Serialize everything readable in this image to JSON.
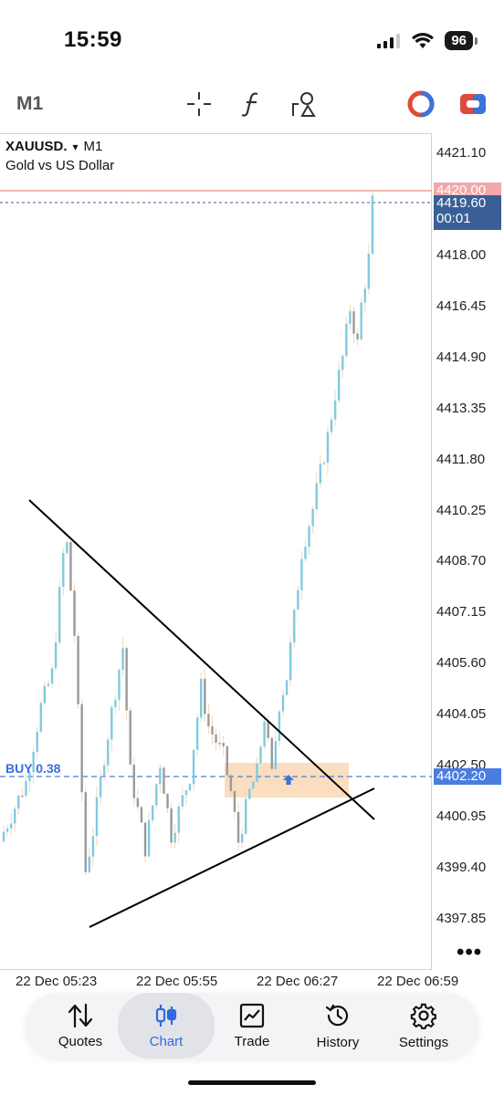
{
  "status_bar": {
    "time": "15:59",
    "battery": "96"
  },
  "toolbar": {
    "period": "M1",
    "icons": [
      "crosshair-icon",
      "function-icon",
      "objects-icon",
      "trade-panel-icon",
      "one-click-icon"
    ]
  },
  "chart": {
    "symbol": "XAUUSD.",
    "symbol_arrow": "▾",
    "timeframe": "M1",
    "description": "Gold vs US Dollar",
    "price_labels": [
      "4421.10",
      "4418.00",
      "4416.45",
      "4414.90",
      "4413.35",
      "4411.80",
      "4410.25",
      "4408.70",
      "4407.15",
      "4405.60",
      "4404.05",
      "4402.50",
      "4400.95",
      "4399.40",
      "4397.85"
    ],
    "ask_tag": {
      "price": "4420.00",
      "color": "#f0a8a8"
    },
    "bid_tag": {
      "price": "4419.60",
      "countdown": "00:01",
      "color": "#3a5f96"
    },
    "buy_line": {
      "label": "BUY 0.38",
      "price": "4402.20",
      "color": "#4a7de0"
    },
    "time_labels": [
      "22 Dec 05:23",
      "22 Dec 05:55",
      "22 Dec 06:27",
      "22 Dec 06:59"
    ],
    "more": "•••",
    "colors": {
      "bull": "#7ecbe0",
      "bear": "#9a9a9a",
      "highlight": "#f9d8b4",
      "trendline": "#000000"
    }
  },
  "nav": {
    "items": [
      {
        "label": "Quotes",
        "icon": "quotes-arrows-icon"
      },
      {
        "label": "Chart",
        "icon": "candles-icon",
        "active": true
      },
      {
        "label": "Trade",
        "icon": "trade-chart-icon"
      },
      {
        "label": "History",
        "icon": "history-clock-icon"
      },
      {
        "label": "Settings",
        "icon": "gear-icon"
      }
    ],
    "active_color": "#2e6ae6"
  }
}
